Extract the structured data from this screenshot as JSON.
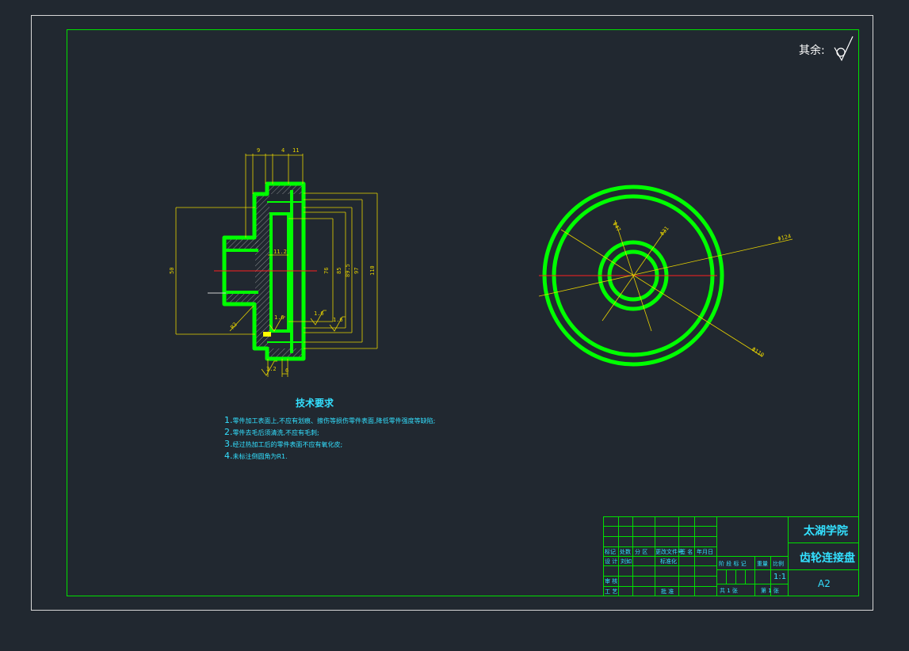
{
  "drawing": {
    "roughness_note": "其余:",
    "technical_requirements": {
      "title": "技术要求",
      "items": [
        {
          "num": "1.",
          "text": "零件加工表面上,不应有划痕、擦伤等损伤零件表面,降低零件强度等缺陷;"
        },
        {
          "num": "2.",
          "text": "零件去毛后须清洗,不应有毛刺;"
        },
        {
          "num": "3.",
          "text": "经过热加工后的零件表面不应有氧化皮;"
        },
        {
          "num": "4.",
          "text": "未标注倒圆角为R1."
        }
      ]
    },
    "section_dims": {
      "top": [
        "9",
        "4",
        "11"
      ],
      "left_height": "50",
      "inner": "11.2",
      "right": [
        "76",
        "85",
        "89.5",
        "97",
        "110"
      ],
      "radius": "R3",
      "bottom": [
        "3.2",
        "6"
      ],
      "roughness": [
        "1.6",
        "1.6",
        "1.6"
      ]
    },
    "view_dims": [
      "Φ47",
      "Φ31",
      "Φ124",
      "Φ110"
    ],
    "title_block": {
      "school": "太湖学院",
      "part_name": "齿轮连接盘",
      "sheet_size": "A2",
      "scale": "1:1",
      "header_labels": [
        "标记",
        "处数",
        "分 区",
        "更改文件号",
        "签 名",
        "年月日"
      ],
      "row_design": [
        "设 计",
        "刘如",
        "标准化"
      ],
      "stage_labels": [
        "阶 段 标 记",
        "重量",
        "比例"
      ],
      "review": "审 核",
      "process": "工 艺",
      "approve": "批 准",
      "sheets_total": "共 1 张",
      "sheet_no": "第 1 张"
    }
  }
}
